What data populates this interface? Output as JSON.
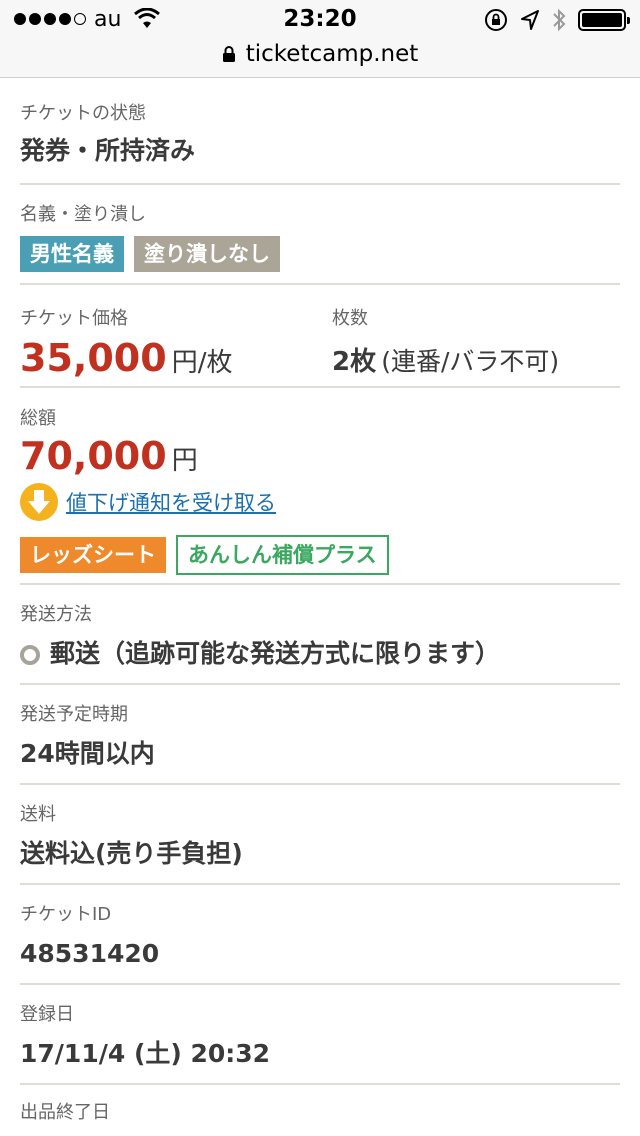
{
  "status_bar": {
    "carrier": "au",
    "time": "23:20"
  },
  "browser": {
    "url": "ticketcamp.net"
  },
  "ticket_state": {
    "label": "チケットの状態",
    "value": "発券・所持済み"
  },
  "name_blackout": {
    "label": "名義・塗り潰し",
    "tag_name": "男性名義",
    "tag_blackout": "塗り潰しなし"
  },
  "price": {
    "label": "チケット価格",
    "amount": "35,000",
    "unit": "円/枚"
  },
  "quantity": {
    "label": "枚数",
    "count": "2枚",
    "note": "(連番/バラ不可)"
  },
  "total": {
    "label": "総額",
    "amount": "70,000",
    "unit": "円",
    "price_drop_link": "値下げ通知を受け取る",
    "tag_red_seat": "レッズシート",
    "tag_insurance": "あんしん補償プラス"
  },
  "shipping_method": {
    "label": "発送方法",
    "value": "郵送（追跡可能な発送方式に限ります）"
  },
  "shipping_schedule": {
    "label": "発送予定時期",
    "value": "24時間以内"
  },
  "shipping_fee": {
    "label": "送料",
    "value": "送料込(売り手負担)"
  },
  "ticket_id": {
    "label": "チケットID",
    "value": "48531420"
  },
  "registered": {
    "label": "登録日",
    "value": "17/11/4 (土) 20:32"
  },
  "listing_end": {
    "label": "出品終了日"
  },
  "colors": {
    "price_red": "#c0311f",
    "tag_blue": "#4a9fb5",
    "tag_beige": "#aaa596",
    "tag_orange": "#ee8a2c",
    "tag_green": "#3aa85f",
    "link_blue": "#1a70b0"
  }
}
